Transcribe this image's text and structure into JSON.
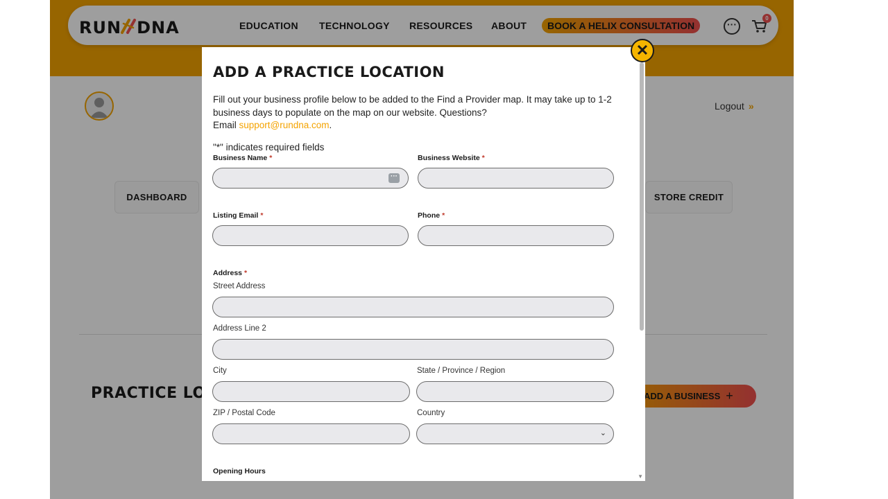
{
  "header": {
    "logo_left": "RUN",
    "logo_right": "DNA",
    "nav": [
      "EDUCATION",
      "TECHNOLOGY",
      "RESOURCES",
      "ABOUT"
    ],
    "book_label": "BOOK A HELIX CONSULTATION",
    "cart_count": "0"
  },
  "account": {
    "logout_label": "Logout",
    "logout_chevron": "»",
    "tabs": {
      "dashboard": "DASHBOARD",
      "store_credit": "STORE CREDIT"
    }
  },
  "practice": {
    "title": "PRACTICE LO",
    "add_business_label": "ADD A BUSINESS",
    "add_icon": "+"
  },
  "modal": {
    "close_symbol": "✕",
    "title": "ADD A PRACTICE LOCATION",
    "intro": "Fill out your business profile below to be added to the Find a Provider map. It may take up to 1-2 business days to populate on the map on our website. Questions?",
    "email_prefix": "Email ",
    "email": "support@rundna.com",
    "email_suffix": ".",
    "required_note": "\"*\" indicates required fields",
    "required_mark": "*",
    "fields": {
      "business_name": "Business Name",
      "business_website": "Business Website",
      "listing_email": "Listing Email",
      "phone": "Phone",
      "address": "Address",
      "street_address": "Street Address",
      "address_line2": "Address Line 2",
      "city": "City",
      "state": "State / Province / Region",
      "zip": "ZIP / Postal Code",
      "country": "Country",
      "opening_hours": "Opening Hours"
    }
  },
  "icons": {
    "close": "close-icon",
    "cart": "cart-icon",
    "more": "more-options-icon",
    "avatar": "user-avatar-icon",
    "autofill": "password-manager-icon",
    "dropdown": "chevron-down-icon"
  },
  "colors": {
    "brand_orange": "#f4a300",
    "brand_red": "#ef4f4f",
    "field_bg": "#e9e9ec"
  }
}
